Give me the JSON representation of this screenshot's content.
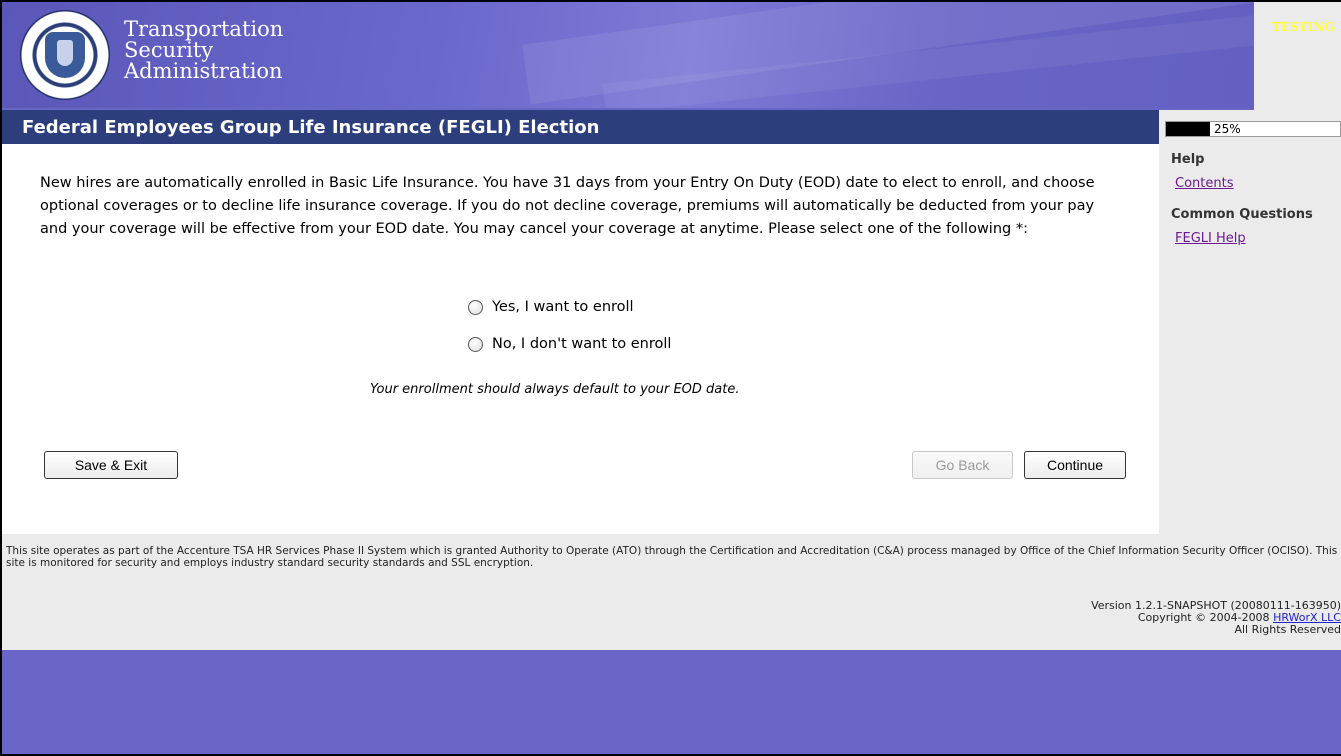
{
  "banner": {
    "agency_lines": [
      "Transportation",
      "Security",
      "Administration"
    ],
    "testing_label": "TESTING"
  },
  "title_bar": {
    "title": "Federal Employees Group Life Insurance (FEGLI) Election"
  },
  "progress": {
    "percent": 25,
    "label": "25%"
  },
  "sidebar": {
    "help_heading": "Help",
    "contents_link": "Contents",
    "common_questions_heading": "Common Questions",
    "fegli_help_link": "FEGLI Help"
  },
  "main": {
    "intro": "New hires are automatically enrolled in Basic Life Insurance. You have 31 days from your Entry On Duty (EOD) date to elect to enroll, and choose optional coverages or to decline life insurance coverage. If you do not decline coverage, premiums will automatically be deducted from your pay and your coverage will be effective from your EOD date. You may cancel your coverage at anytime. Please select one of the following *:",
    "options": [
      {
        "label": "Yes, I want to enroll",
        "selected": false
      },
      {
        "label": "No, I don't want to enroll",
        "selected": false
      }
    ],
    "note": "Your enrollment should always default to your EOD date."
  },
  "buttons": {
    "save_exit": "Save & Exit",
    "go_back": "Go Back",
    "continue": "Continue"
  },
  "footer": {
    "notice": "This site operates as part of the Accenture TSA HR Services Phase II System which is granted Authority to Operate (ATO) through the Certification and Accreditation (C&A) process managed by Office of the Chief Information Security Officer (OCISO). This site is monitored for security and employs industry standard security standards and SSL encryption.",
    "version": "Version 1.2.1-SNAPSHOT (20080111-163950)",
    "copyright_prefix": "Copyright © 2004-2008",
    "copyright_link": "HRWorX LLC",
    "rights": "All Rights Reserved"
  },
  "colors": {
    "title_bar": "#2c3e7c",
    "page_background": "#6a66c8",
    "link": "#6b1a8f"
  }
}
